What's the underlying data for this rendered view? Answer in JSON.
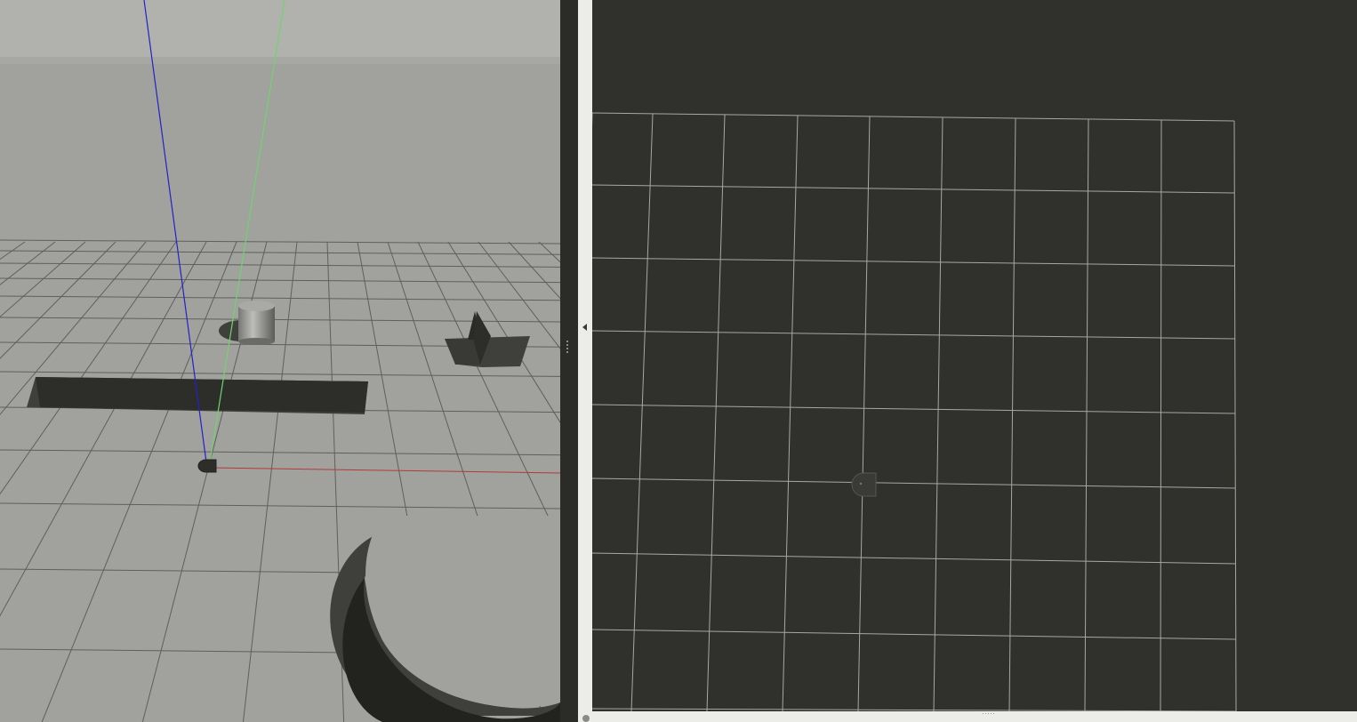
{
  "app": {
    "left_view": "gazebo-3d-viewport",
    "right_view": "rviz-top-view"
  },
  "colors": {
    "sky_top": "#b1b1ad",
    "ground": "#a1a19d",
    "grid_line": "#5f5f5c",
    "obstacle": "#2d2e2a",
    "shadow": "#3f3f3b",
    "axis_x": "#b23a3a",
    "axis_y": "#6fd46f",
    "axis_z": "#2222cc",
    "rviz_bg": "#30302c",
    "rviz_grid": "#a7a7a3",
    "panel_border": "#ecece8",
    "robot": "#3a3b36"
  },
  "icons": {
    "collapse": "triangle-left-icon",
    "splitter": "grip-dots-icon"
  }
}
